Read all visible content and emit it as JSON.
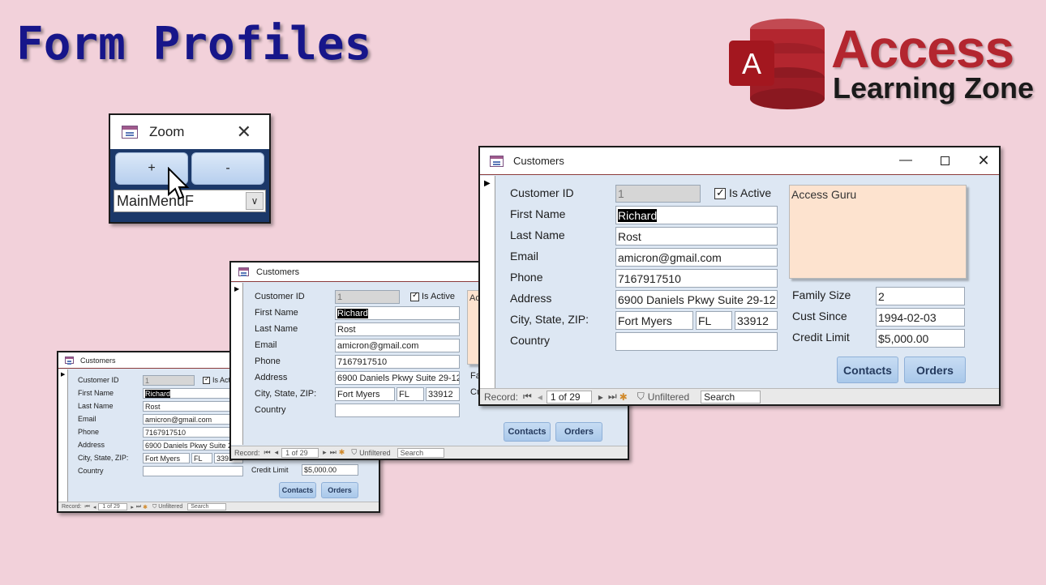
{
  "page": {
    "title": "Form Profiles"
  },
  "logo": {
    "badge_letter": "A",
    "line1": "Access",
    "line2": "Learning Zone",
    "colors": {
      "red": "#b3262f",
      "dark": "#1a1a1a"
    }
  },
  "zoom_window": {
    "title": "Zoom",
    "close_icon": "close-icon",
    "plus_label": "+",
    "minus_label": "-",
    "combo_value": "MainMenuF"
  },
  "customer_form": {
    "title": "Customers",
    "labels": {
      "customer_id": "Customer ID",
      "first_name": "First Name",
      "last_name": "Last Name",
      "email": "Email",
      "phone": "Phone",
      "address": "Address",
      "city_state_zip": "City, State, ZIP:",
      "country": "Country",
      "is_active": "Is Active",
      "family_size": "Family Size",
      "cust_since": "Cust Since",
      "credit_limit": "Credit Limit"
    },
    "values": {
      "customer_id": "1",
      "first_name": "Richard",
      "last_name": "Rost",
      "email": "amicron@gmail.com",
      "phone": "7167917510",
      "address": "6900 Daniels Pkwy Suite 29-12",
      "city": "Fort Myers",
      "state": "FL",
      "zip": "33912",
      "country": "",
      "notes": "Access Guru",
      "notes_partial": "Ac",
      "family_size": "2",
      "cust_since": "1994-02-03",
      "credit_limit": "$5,000.00",
      "partial_zip": "3391",
      "partial_is_active": "Is Act",
      "partial_family_size": "Fa",
      "partial_cust_since": "Cu"
    },
    "buttons": {
      "contacts": "Contacts",
      "orders": "Orders"
    },
    "nav": {
      "record_label": "Record:",
      "position": "1 of 29",
      "filter": "Unfiltered",
      "search": "Search"
    }
  }
}
